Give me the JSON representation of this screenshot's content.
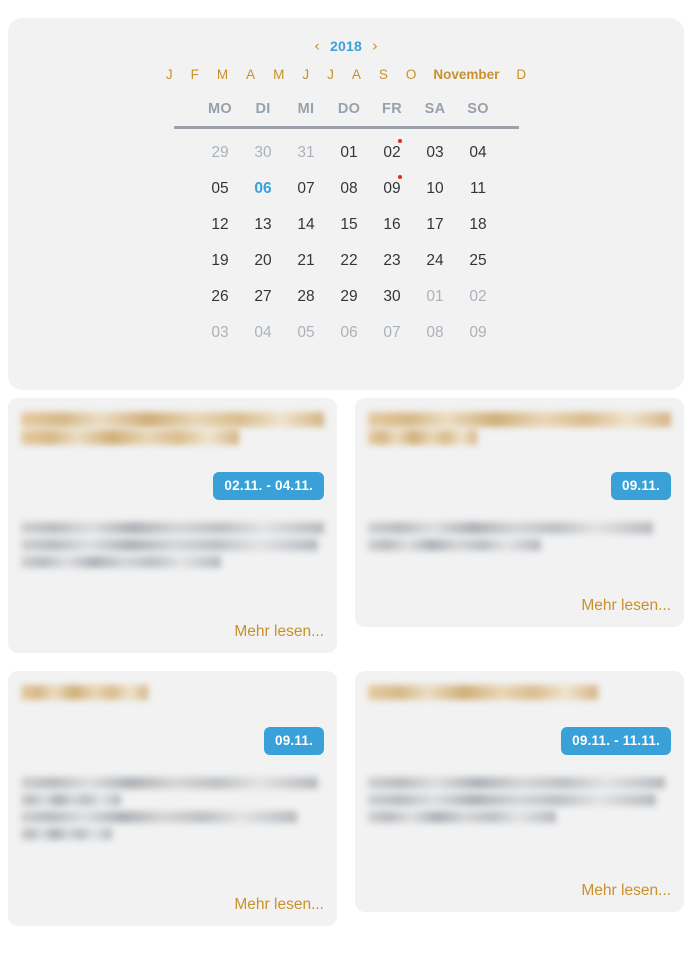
{
  "calendar": {
    "year": "2018",
    "prev_year_icon": "chevron-left-icon",
    "next_year_icon": "chevron-right-icon",
    "prev_arrow": "‹",
    "next_arrow": "›",
    "months": [
      {
        "label": "J",
        "full": "Januar",
        "active": false
      },
      {
        "label": "F",
        "full": "Februar",
        "active": false
      },
      {
        "label": "M",
        "full": "März",
        "active": false
      },
      {
        "label": "A",
        "full": "April",
        "active": false
      },
      {
        "label": "M",
        "full": "Mai",
        "active": false
      },
      {
        "label": "J",
        "full": "Juni",
        "active": false
      },
      {
        "label": "J",
        "full": "Juli",
        "active": false
      },
      {
        "label": "A",
        "full": "August",
        "active": false
      },
      {
        "label": "S",
        "full": "September",
        "active": false
      },
      {
        "label": "O",
        "full": "Oktober",
        "active": false
      },
      {
        "label": "November",
        "full": "November",
        "active": true
      },
      {
        "label": "D",
        "full": "Dezember",
        "active": false
      }
    ],
    "weekdays": [
      "MO",
      "DI",
      "MI",
      "DO",
      "FR",
      "SA",
      "SO"
    ],
    "weeks": [
      [
        {
          "day": "29",
          "muted": true,
          "today": false,
          "dot": false
        },
        {
          "day": "30",
          "muted": true,
          "today": false,
          "dot": false
        },
        {
          "day": "31",
          "muted": true,
          "today": false,
          "dot": false
        },
        {
          "day": "01",
          "muted": false,
          "today": false,
          "dot": false
        },
        {
          "day": "02",
          "muted": false,
          "today": false,
          "dot": true
        },
        {
          "day": "03",
          "muted": false,
          "today": false,
          "dot": false
        },
        {
          "day": "04",
          "muted": false,
          "today": false,
          "dot": false
        }
      ],
      [
        {
          "day": "05",
          "muted": false,
          "today": false,
          "dot": false
        },
        {
          "day": "06",
          "muted": false,
          "today": true,
          "dot": false
        },
        {
          "day": "07",
          "muted": false,
          "today": false,
          "dot": false
        },
        {
          "day": "08",
          "muted": false,
          "today": false,
          "dot": false
        },
        {
          "day": "09",
          "muted": false,
          "today": false,
          "dot": true
        },
        {
          "day": "10",
          "muted": false,
          "today": false,
          "dot": false
        },
        {
          "day": "11",
          "muted": false,
          "today": false,
          "dot": false
        }
      ],
      [
        {
          "day": "12",
          "muted": false,
          "today": false,
          "dot": false
        },
        {
          "day": "13",
          "muted": false,
          "today": false,
          "dot": false
        },
        {
          "day": "14",
          "muted": false,
          "today": false,
          "dot": false
        },
        {
          "day": "15",
          "muted": false,
          "today": false,
          "dot": false
        },
        {
          "day": "16",
          "muted": false,
          "today": false,
          "dot": false
        },
        {
          "day": "17",
          "muted": false,
          "today": false,
          "dot": false
        },
        {
          "day": "18",
          "muted": false,
          "today": false,
          "dot": false
        }
      ],
      [
        {
          "day": "19",
          "muted": false,
          "today": false,
          "dot": false
        },
        {
          "day": "20",
          "muted": false,
          "today": false,
          "dot": false
        },
        {
          "day": "21",
          "muted": false,
          "today": false,
          "dot": false
        },
        {
          "day": "22",
          "muted": false,
          "today": false,
          "dot": false
        },
        {
          "day": "23",
          "muted": false,
          "today": false,
          "dot": false
        },
        {
          "day": "24",
          "muted": false,
          "today": false,
          "dot": false
        },
        {
          "day": "25",
          "muted": false,
          "today": false,
          "dot": false
        }
      ],
      [
        {
          "day": "26",
          "muted": false,
          "today": false,
          "dot": false
        },
        {
          "day": "27",
          "muted": false,
          "today": false,
          "dot": false
        },
        {
          "day": "28",
          "muted": false,
          "today": false,
          "dot": false
        },
        {
          "day": "29",
          "muted": false,
          "today": false,
          "dot": false
        },
        {
          "day": "30",
          "muted": false,
          "today": false,
          "dot": false
        },
        {
          "day": "01",
          "muted": true,
          "today": false,
          "dot": false
        },
        {
          "day": "02",
          "muted": true,
          "today": false,
          "dot": false
        }
      ],
      [
        {
          "day": "03",
          "muted": true,
          "today": false,
          "dot": false
        },
        {
          "day": "04",
          "muted": true,
          "today": false,
          "dot": false
        },
        {
          "day": "05",
          "muted": true,
          "today": false,
          "dot": false
        },
        {
          "day": "06",
          "muted": true,
          "today": false,
          "dot": false
        },
        {
          "day": "07",
          "muted": true,
          "today": false,
          "dot": false
        },
        {
          "day": "08",
          "muted": true,
          "today": false,
          "dot": false
        },
        {
          "day": "09",
          "muted": true,
          "today": false,
          "dot": false
        }
      ]
    ]
  },
  "events": [
    {
      "title_redacted": true,
      "title_lines": [
        100,
        72
      ],
      "date_badge": "02.11. - 04.11.",
      "body_redacted": true,
      "body_lines": [
        100,
        98,
        66
      ],
      "more_label": "Mehr lesen...",
      "height_class": "h-tall"
    },
    {
      "title_redacted": true,
      "title_lines": [
        100,
        36
      ],
      "date_badge": "09.11.",
      "body_redacted": true,
      "body_lines": [
        94,
        57
      ],
      "more_label": "Mehr lesen...",
      "height_class": "h-short"
    },
    {
      "title_redacted": true,
      "title_lines": [
        42
      ],
      "date_badge": "09.11.",
      "body_redacted": true,
      "body_lines": [
        98,
        33,
        91,
        30
      ],
      "more_label": "Mehr lesen...",
      "height_class": "h-med"
    },
    {
      "title_redacted": true,
      "title_lines": [
        76
      ],
      "date_badge": "09.11. - 11.11.",
      "body_redacted": true,
      "body_lines": [
        98,
        95,
        62
      ],
      "more_label": "Mehr lesen...",
      "height_class": "h-tall2"
    }
  ],
  "colors": {
    "accent_blue": "#3aa0d8",
    "accent_gold": "#c8912c",
    "panel_bg": "#f2f2f2",
    "page_bg": "#ffffff",
    "divider": "#9aa3ab",
    "muted_day": "#abb2ba",
    "day_text": "#333538",
    "event_dot": "#e02b20",
    "weekday_header": "#99a1a9"
  }
}
